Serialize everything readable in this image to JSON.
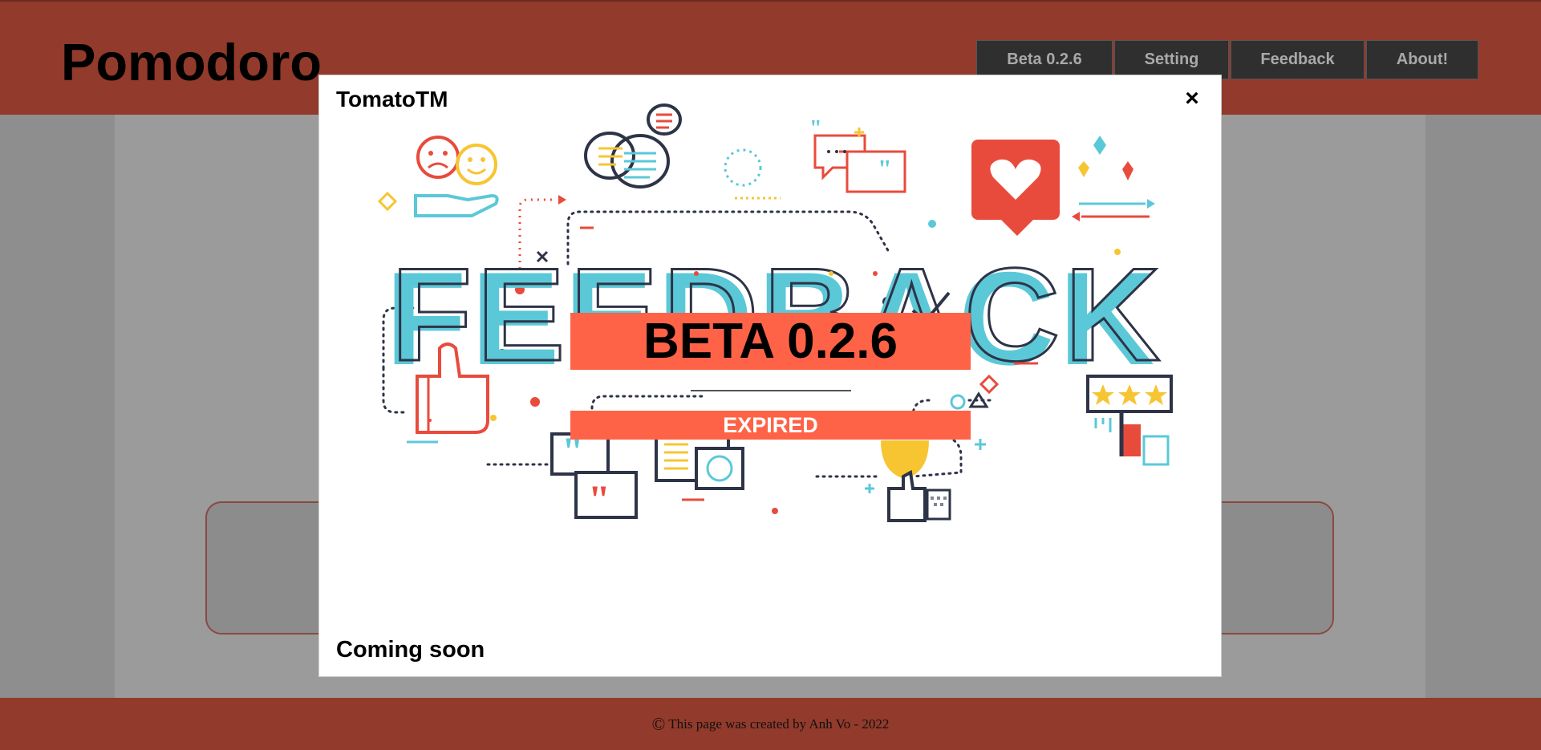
{
  "header": {
    "logo": "Pomodoro",
    "nav": [
      "Beta 0.2.6",
      "Setting",
      "Feedback",
      "About!"
    ]
  },
  "modal": {
    "title": "TomatoTM",
    "close": "×",
    "illustration_word": "FEEDBACK",
    "beta_label": "BETA 0.2.6",
    "expired_label": "EXPIRED",
    "footer_text": "Coming soon"
  },
  "footer": {
    "copyright_symbol": "©",
    "text": "This page was created by Anh Vo - 2022"
  },
  "colors": {
    "brand": "#923a2b",
    "banner": "#ff6347",
    "teal": "#5bc8d8",
    "navy": "#2e3447",
    "yellow": "#f7c531",
    "red": "#e84b3c"
  },
  "icons": [
    "close-icon",
    "chat-bubbles-icon",
    "heart-icon",
    "thumbs-up-icon",
    "quote-icon",
    "trophy-icon",
    "stars-rating-icon",
    "smiley-icon",
    "sad-face-icon"
  ]
}
